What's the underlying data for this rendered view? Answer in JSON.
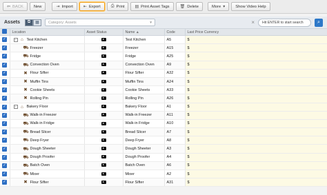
{
  "toolbar": {
    "back_label": "BACK",
    "new_label": "New",
    "import_label": "Import",
    "export_label": "Export",
    "print_label": "Print",
    "print_tags_label": "Print Asset Tags",
    "delete_label": "Delete",
    "more_label": "More",
    "video_label": "Show Video Help"
  },
  "assetbar": {
    "title": "Assets",
    "category_placeholder": "Category: Assets",
    "search_placeholder": "Hit ENTER to start search"
  },
  "columns": {
    "location": "Location",
    "status": "Asset Status",
    "name": "Name",
    "code": "Code",
    "lpc": "Last Price Currency"
  },
  "rows": [
    {
      "loc": "Test Kitchen",
      "group": true,
      "name": "Test Kitchen",
      "code": "A5",
      "cur": "$",
      "icon": "folder-icon"
    },
    {
      "loc": "Freezer",
      "group": false,
      "name": "Freezer",
      "code": "A15",
      "cur": "$",
      "icon": "appliance-icon"
    },
    {
      "loc": "Fridge",
      "group": false,
      "name": "Fridge",
      "code": "A25",
      "cur": "$",
      "icon": "appliance-icon"
    },
    {
      "loc": "Convection Oven",
      "group": false,
      "name": "Convection Oven",
      "code": "A9",
      "cur": "$",
      "icon": "appliance-icon"
    },
    {
      "loc": "Flour Sifter",
      "group": false,
      "name": "Flour Sifter",
      "code": "A32",
      "cur": "$",
      "icon": "tool-icon"
    },
    {
      "loc": "Muffin Tins",
      "group": false,
      "name": "Muffin Tins",
      "code": "A24",
      "cur": "$",
      "icon": "tool-icon"
    },
    {
      "loc": "Cookie Sheets",
      "group": false,
      "name": "Cookie Sheets",
      "code": "A33",
      "cur": "$",
      "icon": "tool-icon"
    },
    {
      "loc": "Rolling Pin",
      "group": false,
      "name": "Rolling Pin",
      "code": "A26",
      "cur": "$",
      "icon": "tool-icon"
    },
    {
      "loc": "Bakery Floor",
      "group": true,
      "name": "Bakery Floor",
      "code": "A1",
      "cur": "$",
      "icon": "folder-icon"
    },
    {
      "loc": "Walk-in Freezer",
      "group": false,
      "name": "Walk-in Freezer",
      "code": "A11",
      "cur": "$",
      "icon": "appliance-icon"
    },
    {
      "loc": "Walk-in Fridge",
      "group": false,
      "name": "Walk-in Fridge",
      "code": "A10",
      "cur": "$",
      "icon": "appliance-icon"
    },
    {
      "loc": "Bread Slicer",
      "group": false,
      "name": "Bread Slicer",
      "code": "A7",
      "cur": "$",
      "icon": "appliance-icon"
    },
    {
      "loc": "Deep Fryer",
      "group": false,
      "name": "Deep Fryer",
      "code": "A8",
      "cur": "$",
      "icon": "appliance-icon"
    },
    {
      "loc": "Dough Sheeter",
      "group": false,
      "name": "Dough Sheeter",
      "code": "A3",
      "cur": "$",
      "icon": "appliance-icon"
    },
    {
      "loc": "Dough Proofer",
      "group": false,
      "name": "Dough Proofer",
      "code": "A4",
      "cur": "$",
      "icon": "appliance-icon"
    },
    {
      "loc": "Batch Oven",
      "group": false,
      "name": "Batch Oven",
      "code": "A6",
      "cur": "$",
      "icon": "appliance-icon"
    },
    {
      "loc": "Mixer",
      "group": false,
      "name": "Mixer",
      "code": "A2",
      "cur": "$",
      "icon": "appliance-icon"
    },
    {
      "loc": "Flour Sifter",
      "group": false,
      "name": "Flour Sifter",
      "code": "A31",
      "cur": "$",
      "icon": "tool-icon"
    }
  ]
}
